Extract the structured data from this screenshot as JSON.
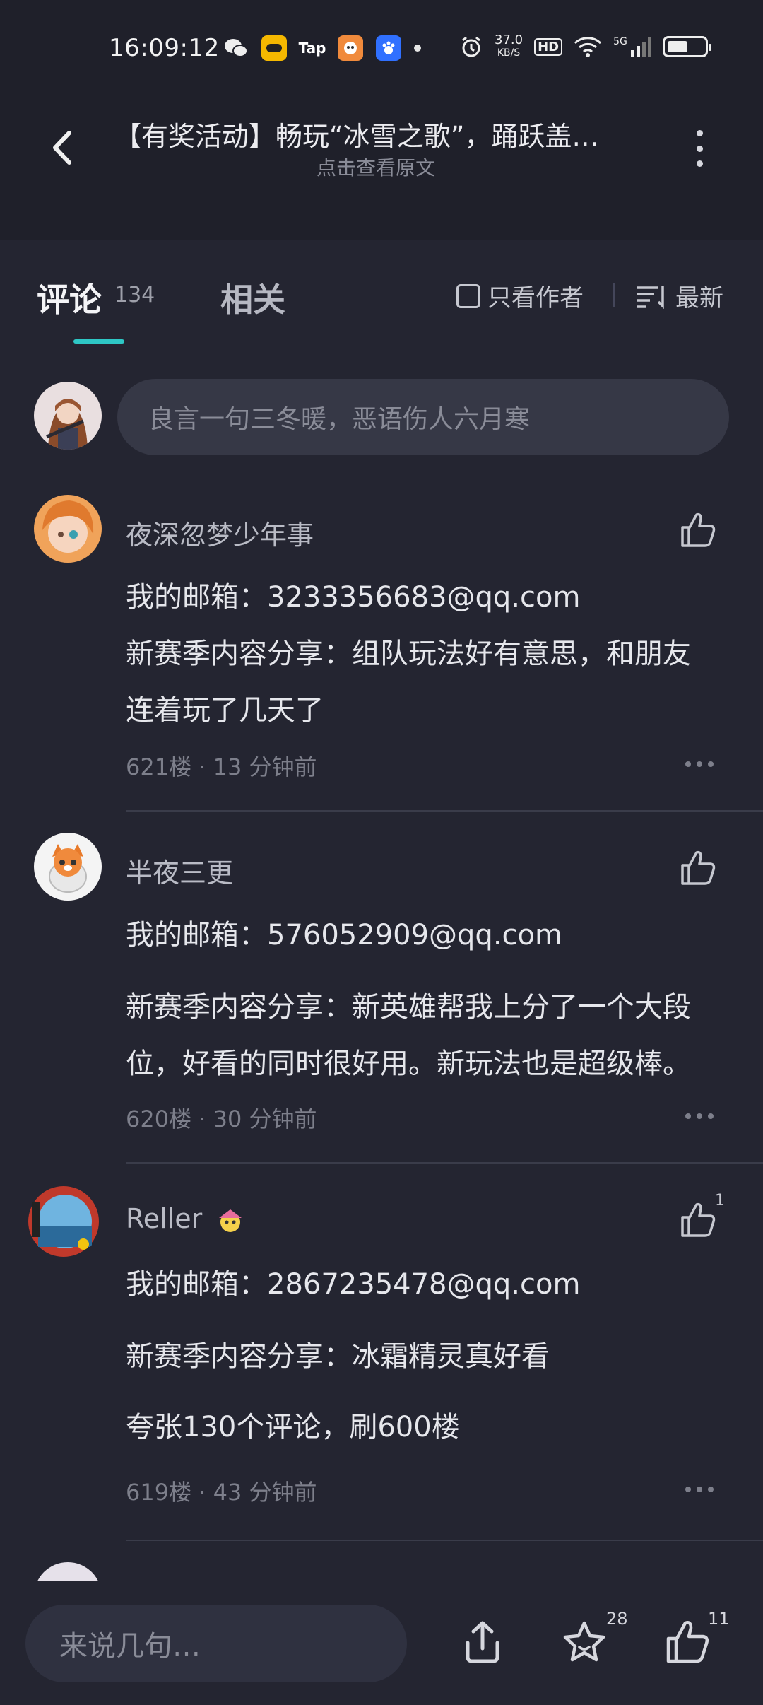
{
  "status_bar": {
    "time": "16:09:12",
    "apps": [
      "wechat-icon",
      "app-icon-yellow",
      "Tap",
      "app-icon-orange",
      "baidu-icon"
    ],
    "tap_label": "Tap",
    "speed_top": "37.0",
    "speed_bottom": "KB/S",
    "hd": "HD",
    "network": "5G",
    "battery_level": 0.55
  },
  "header": {
    "title": "【有奖活动】畅玩“冰雪之歌”，踊跃盖…",
    "subtitle": "点击查看原文"
  },
  "tabs": {
    "comments_label": "评论",
    "comments_count": "134",
    "related_label": "相关",
    "author_only_label": "只看作者",
    "sort_label": "最新"
  },
  "composer": {
    "placeholder": "良言一句三冬暖，恶语伤人六月寒"
  },
  "comments": [
    {
      "name": "夜深忽梦少年事",
      "lines": [
        "我的邮箱：3233356683@qq.com",
        "新赛季内容分享：组队玩法好有意思，和朋友",
        "连着玩了几天了"
      ],
      "meta": "621楼 · 13 分钟前",
      "likes": ""
    },
    {
      "name": "半夜三更",
      "lines": [
        "我的邮箱：576052909@qq.com",
        "新赛季内容分享：新英雄帮我上分了一个大段",
        "位，好看的同时很好用。新玩法也是超级棒。"
      ],
      "meta": "620楼 · 30 分钟前",
      "likes": ""
    },
    {
      "name": "Reller",
      "lines": [
        "我的邮箱：2867235478@qq.com",
        "新赛季内容分享：冰霜精灵真好看",
        "夸张130个评论，刷600楼"
      ],
      "meta": "619楼 · 43 分钟前",
      "likes": "1"
    }
  ],
  "bottom_bar": {
    "placeholder": "来说几句…",
    "favorites_count": "28",
    "likes_count": "11"
  },
  "colors": {
    "background": "#242531",
    "accent": "#2ec7c5"
  }
}
